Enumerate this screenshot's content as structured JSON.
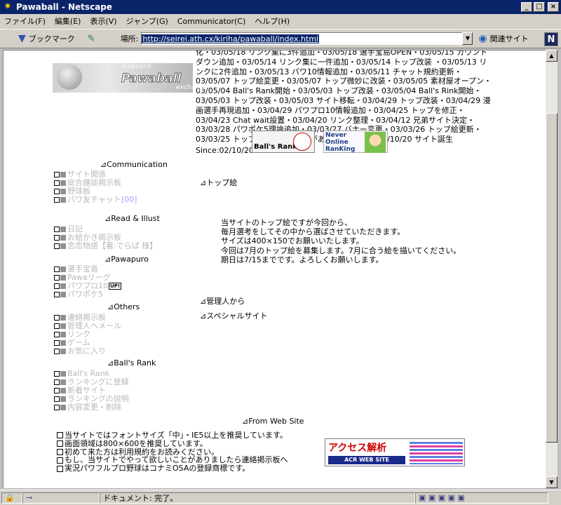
{
  "window": {
    "title": "Pawaball - Netscape",
    "minimize": "_",
    "maximize": "□",
    "close": "×"
  },
  "menu": [
    "ファイル(F)",
    "編集(E)",
    "表示(V)",
    "ジャンプ(G)",
    "Communicator(C)",
    "ヘルプ(H)"
  ],
  "toolbar": {
    "bookmark_label": "ブックマーク",
    "location_label": "場所:",
    "url": "http://seirei.ath.cx/kiriha/pawaball/index.html",
    "related_label": "関連サイト"
  },
  "header": {
    "news": "化・03/05/18 リンク集に3件追加・03/05/18 選手宝島OPEN・03/05/15 カウント\nダウン追加・03/05/14 リンク集に一件追加・03/05/14 トップ改装 ・03/05/13 リ\nンクに2件追加・03/05/13 パワ10情報追加・03/05/11 チャット規約更新・\n03/05/07 トップ絵変更・03/05/07 トップ微妙に改装・03/05/05 素材屋オープン・\n03/05/04 Ball's Rank開始・03/05/03 トップ改装・03/05/04 Ball's Rink開始・\n03/05/03 トップ改装・03/05/03 サイト移転・03/04/29 トップ改装・03/04/29 漫\n画選手再現追加・03/04/29 パワプロ10情報追加・03/04/25 トップを修正・\n03/04/23 Chat wait設置・03/04/20 リンク整理・03/04/12 兄弟サイト決定・\n03/03/28 パワポケ5理論追加・03/03/27 バナー変更・03/03/26 トップ絵更新・\n03/03/25 トップ絵更新・データがありません。・2002/10/20 サイト誕生",
    "logo_sub": "capture",
    "logo_main": "Pawaball",
    "logo_sub2": "exchange",
    "since": "Since:02/10/20",
    "ballsrank_banner": "Ball's Rank",
    "never_online": "Never\nOnline\nRanKing"
  },
  "nav": {
    "communication": {
      "title": "⊿Communication",
      "items": [
        "サイト関係",
        "総合雑談掲示板",
        "野球板",
        "パワ友チャット"
      ],
      "chat_tag": "[00]"
    },
    "read": {
      "title": "⊿Read & Illust",
      "items": [
        "日記",
        "お絵かき掲示板",
        "恋恋物語【著:でらぱ 様】"
      ]
    },
    "pawapuro": {
      "title": "⊿Pawapuro",
      "items": [
        "選手宝島",
        "Pawaリーグ",
        "パワプロ10",
        "パワポケ5"
      ],
      "up": "UP!"
    },
    "others": {
      "title": "⊿Others",
      "items": [
        "連絡掲示板",
        "管理人へメール",
        "リンク",
        "ゲーム",
        "お気に入り"
      ]
    },
    "ballsrank": {
      "title": "⊿Ball's Rank",
      "items": [
        "Ball's Rank",
        "ランキングに登録",
        "新着サイト",
        "ランキングの説明",
        "内容変更・削除"
      ]
    }
  },
  "main": {
    "top_title": "⊿トップ絵",
    "message": "当サイトのトップ絵ですが今回から、\n毎月選考をしてその中から選ばさせていただきます。\nサイズは400×150でお願いいたします。\n今回は7月のトップ絵を募集します。7月に合う絵を描いてください。\n期日は7/15までです。よろしくお願いします。",
    "admin_title": "⊿管理人から",
    "special_title": "⊿スペシャルサイト"
  },
  "footer": {
    "web_title": "⊿From Web Site",
    "notes": [
      "当サイトではフォントサイズ「中」・IE5以上を推奨しています。",
      "画面領域は800×600を推奨しています。",
      "初めて来た方は利用規約をお読みください。",
      "もし、当サイトでやって欲しいことがありましたら連絡掲示板へ",
      "実況パワフルプロ野球はコナミOSAの登録商標です。"
    ],
    "acr_title": "アクセス解析",
    "acr_sub": "ACR WEB SITE"
  },
  "status": {
    "text": "ドキュメント: 完了。"
  }
}
